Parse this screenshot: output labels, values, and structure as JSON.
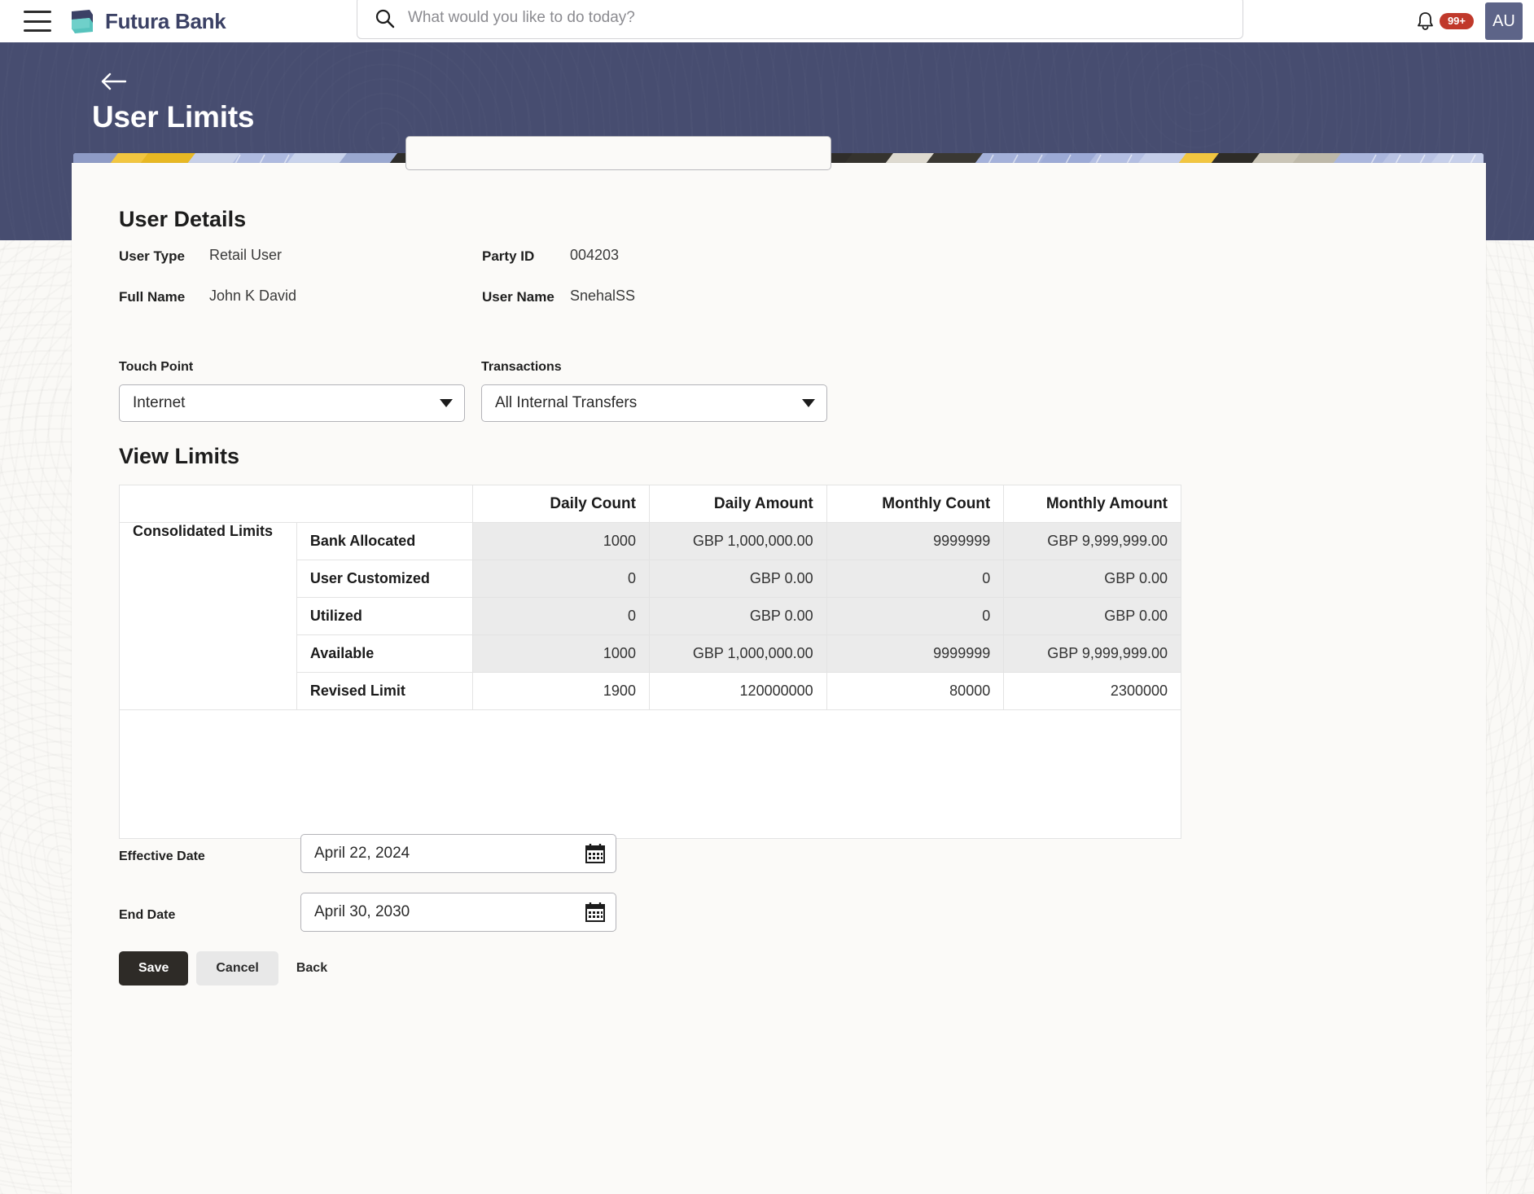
{
  "topbar": {
    "menu_icon": "hamburger-icon",
    "brand": "Futura Bank",
    "brand_logo_icon": "futura-bank-logo-icon",
    "search_icon": "search-icon",
    "search_placeholder": "What would you like to do today?",
    "search_value": "",
    "bell_icon": "notification-bell-icon",
    "notification_badge": "99+",
    "avatar_initials": "AU"
  },
  "hero": {
    "back_icon": "back-arrow-icon",
    "title": "User Limits",
    "bg_color": "#474d70"
  },
  "user_details": {
    "heading": "User Details",
    "fields": [
      {
        "label": "User Type",
        "value": "Retail User"
      },
      {
        "label": "Party ID",
        "value": "004203"
      },
      {
        "label": "Full Name",
        "value": "John K David"
      },
      {
        "label": "User Name",
        "value": "SnehalSS"
      }
    ]
  },
  "filters": {
    "touch_point": {
      "label": "Touch Point",
      "value": "Internet",
      "caret_icon": "chevron-down-icon"
    },
    "transactions": {
      "label": "Transactions",
      "value": "All Internal Transfers",
      "caret_icon": "chevron-down-icon"
    }
  },
  "view_limits": {
    "heading": "View Limits",
    "columns": [
      "",
      "",
      "Daily Count",
      "Daily Amount",
      "Monthly Count",
      "Monthly Amount"
    ],
    "group_label": "Consolidated Limits",
    "rows": [
      {
        "label": "Bank Allocated",
        "daily_count": "1000",
        "daily_amount": "GBP 1,000,000.00",
        "monthly_count": "9999999",
        "monthly_amount": "GBP 9,999,999.00"
      },
      {
        "label": "User Customized",
        "daily_count": "0",
        "daily_amount": "GBP 0.00",
        "monthly_count": "0",
        "monthly_amount": "GBP 0.00"
      },
      {
        "label": "Utilized",
        "daily_count": "0",
        "daily_amount": "GBP 0.00",
        "monthly_count": "0",
        "monthly_amount": "GBP 0.00"
      },
      {
        "label": "Available",
        "daily_count": "1000",
        "daily_amount": "GBP 1,000,000.00",
        "monthly_count": "9999999",
        "monthly_amount": "GBP 9,999,999.00"
      },
      {
        "label": "Revised Limit",
        "daily_count": "1900",
        "daily_amount": "120000000",
        "monthly_count": "80000",
        "monthly_amount": "2300000"
      }
    ]
  },
  "dates": {
    "effective": {
      "label": "Effective Date",
      "value": "April 22, 2024",
      "icon": "calendar-icon"
    },
    "end": {
      "label": "End Date",
      "value": "April 30, 2030",
      "icon": "calendar-icon"
    }
  },
  "actions": {
    "save": "Save",
    "cancel": "Cancel",
    "back": "Back"
  },
  "colors": {
    "hero": "#474d70",
    "badge": "#c0392b",
    "avatar": "#5d6488",
    "save_button": "#2e2b27",
    "brand_text": "#3b4165"
  }
}
